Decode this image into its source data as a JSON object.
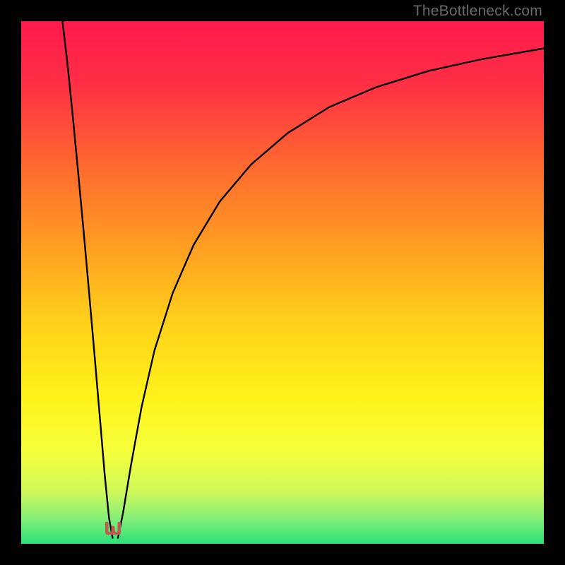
{
  "watermark": "TheBottleneck.com",
  "colors": {
    "frame": "#000000",
    "gradient_stops": [
      {
        "offset": 0.0,
        "color": "#ff1a4d"
      },
      {
        "offset": 0.12,
        "color": "#ff2f45"
      },
      {
        "offset": 0.28,
        "color": "#ff6a2f"
      },
      {
        "offset": 0.42,
        "color": "#ff9a22"
      },
      {
        "offset": 0.58,
        "color": "#ffd21a"
      },
      {
        "offset": 0.72,
        "color": "#fff21a"
      },
      {
        "offset": 0.82,
        "color": "#f6ff3a"
      },
      {
        "offset": 0.9,
        "color": "#cff95a"
      },
      {
        "offset": 0.95,
        "color": "#87ef77"
      },
      {
        "offset": 1.0,
        "color": "#2de07a"
      }
    ],
    "curve": "#000000",
    "marker_fill": "#c35a4e",
    "marker_edge": "#c35a4e"
  },
  "marker": {
    "x_frac": 0.176,
    "y_frac": 0.975
  },
  "chart_data": {
    "type": "line",
    "title": "",
    "xlabel": "",
    "ylabel": "",
    "xlim": [
      0,
      1
    ],
    "ylim": [
      0,
      1
    ],
    "series": [
      {
        "name": "left-branch",
        "x": [
          0.079,
          0.09,
          0.1,
          0.11,
          0.12,
          0.13,
          0.14,
          0.15,
          0.16,
          0.168,
          0.175
        ],
        "y": [
          1.0,
          0.905,
          0.805,
          0.7,
          0.592,
          0.48,
          0.365,
          0.248,
          0.13,
          0.05,
          0.01
        ]
      },
      {
        "name": "right-branch",
        "x": [
          0.185,
          0.195,
          0.21,
          0.23,
          0.255,
          0.29,
          0.33,
          0.38,
          0.44,
          0.51,
          0.59,
          0.68,
          0.78,
          0.88,
          1.0
        ],
        "y": [
          0.01,
          0.06,
          0.15,
          0.26,
          0.37,
          0.48,
          0.572,
          0.655,
          0.726,
          0.786,
          0.836,
          0.874,
          0.905,
          0.927,
          0.948
        ]
      }
    ],
    "annotations": [
      {
        "type": "marker",
        "shape": "u",
        "x": 0.176,
        "y": 0.018
      }
    ],
    "background": "vertical-gradient red→orange→yellow→green"
  }
}
